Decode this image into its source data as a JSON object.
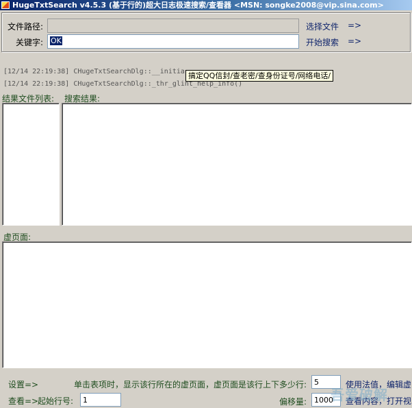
{
  "window": {
    "title": "HugeTxtSearch v4.5.3 (基于行的)超大日志极速搜索/查看器 <MSN: songke2008@vip.sina.com>"
  },
  "form": {
    "path_label": "文件路径:",
    "path_value": "",
    "keyword_label": "关键字:",
    "keyword_value": "OK",
    "select_file_label": "选择文件",
    "start_search_label": "开始搜索",
    "arrow": "=>"
  },
  "log": {
    "line1": "[12/14 22:19:38] CHugeTxtSearchDlg::__initia",
    "line2": "[12/14 22:19:38] CHugeTxtSearchDlg::_thr_glint_help_info()"
  },
  "tooltip": {
    "text": "搞定QQ信封/查老密/查身份证号/网络电话/"
  },
  "panels": {
    "result_files_label": "结果文件列表:",
    "search_results_label": "搜索结果:",
    "virtual_page_label": "虚页面:"
  },
  "bottom": {
    "settings_label": "设置=>",
    "hint": "单击表项时，显示该行所在的虚页面，虚页面是该行上下多少行:",
    "lines_value": "5",
    "use_editor_label": "使用法值，编辑虚",
    "view_label": "查看=>",
    "start_line_label": "起始行号:",
    "start_line_value": "1",
    "offset_label": "偏移量:",
    "offset_value": "1000",
    "view_content_label": "查看内容，打开视"
  },
  "watermark": {
    "text": "吾爱破解"
  }
}
